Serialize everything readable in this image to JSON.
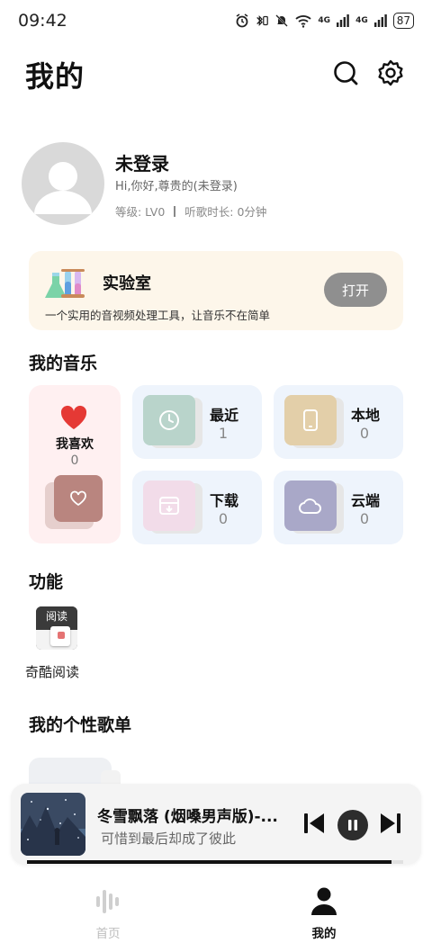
{
  "status_bar": {
    "time": "09:42",
    "wifi_label": "6",
    "net1": "4G",
    "net2": "4G",
    "battery": "87"
  },
  "header": {
    "title": "我的",
    "search_icon": "search-icon",
    "settings_icon": "gear-icon"
  },
  "profile": {
    "name": "未登录",
    "greeting": "Hi,你好,尊贵的(未登录)",
    "level": "等级: LV0",
    "listen_time": "听歌时长: 0分钟"
  },
  "lab": {
    "title": "实验室",
    "description": "一个实用的音视频处理工具，让音乐不在简单",
    "open_label": "打开"
  },
  "my_music": {
    "title": "我的音乐",
    "favorite": {
      "label": "我喜欢",
      "count": "0"
    },
    "tiles": [
      {
        "label": "最近",
        "count": "1",
        "color": "#b9d4cb",
        "icon": "clock-icon"
      },
      {
        "label": "本地",
        "count": "0",
        "color": "#e3cfa9",
        "icon": "phone-icon"
      },
      {
        "label": "下载",
        "count": "0",
        "color": "#f2dce9",
        "icon": "download-icon"
      },
      {
        "label": "云端",
        "count": "0",
        "color": "#a9a8c8",
        "icon": "cloud-icon"
      }
    ]
  },
  "functions": {
    "title": "功能",
    "items": [
      {
        "label": "奇酷阅读",
        "icon_text": "阅读"
      }
    ]
  },
  "playlists": {
    "title": "我的个性歌单"
  },
  "player": {
    "song_title": "冬雪飘落 (烟嗓男声版)-...",
    "lyric": "可惜到最后却成了彼此",
    "progress": 0.97
  },
  "tabbar": {
    "tabs": [
      {
        "label": "首页",
        "active": false
      },
      {
        "label": "我的",
        "active": true
      }
    ]
  },
  "colors": {
    "accent_heart": "#e53935",
    "lab_bg": "#fdf6ea",
    "fav_bg": "#fff0f1",
    "tile_bg": "#eef4fc"
  }
}
